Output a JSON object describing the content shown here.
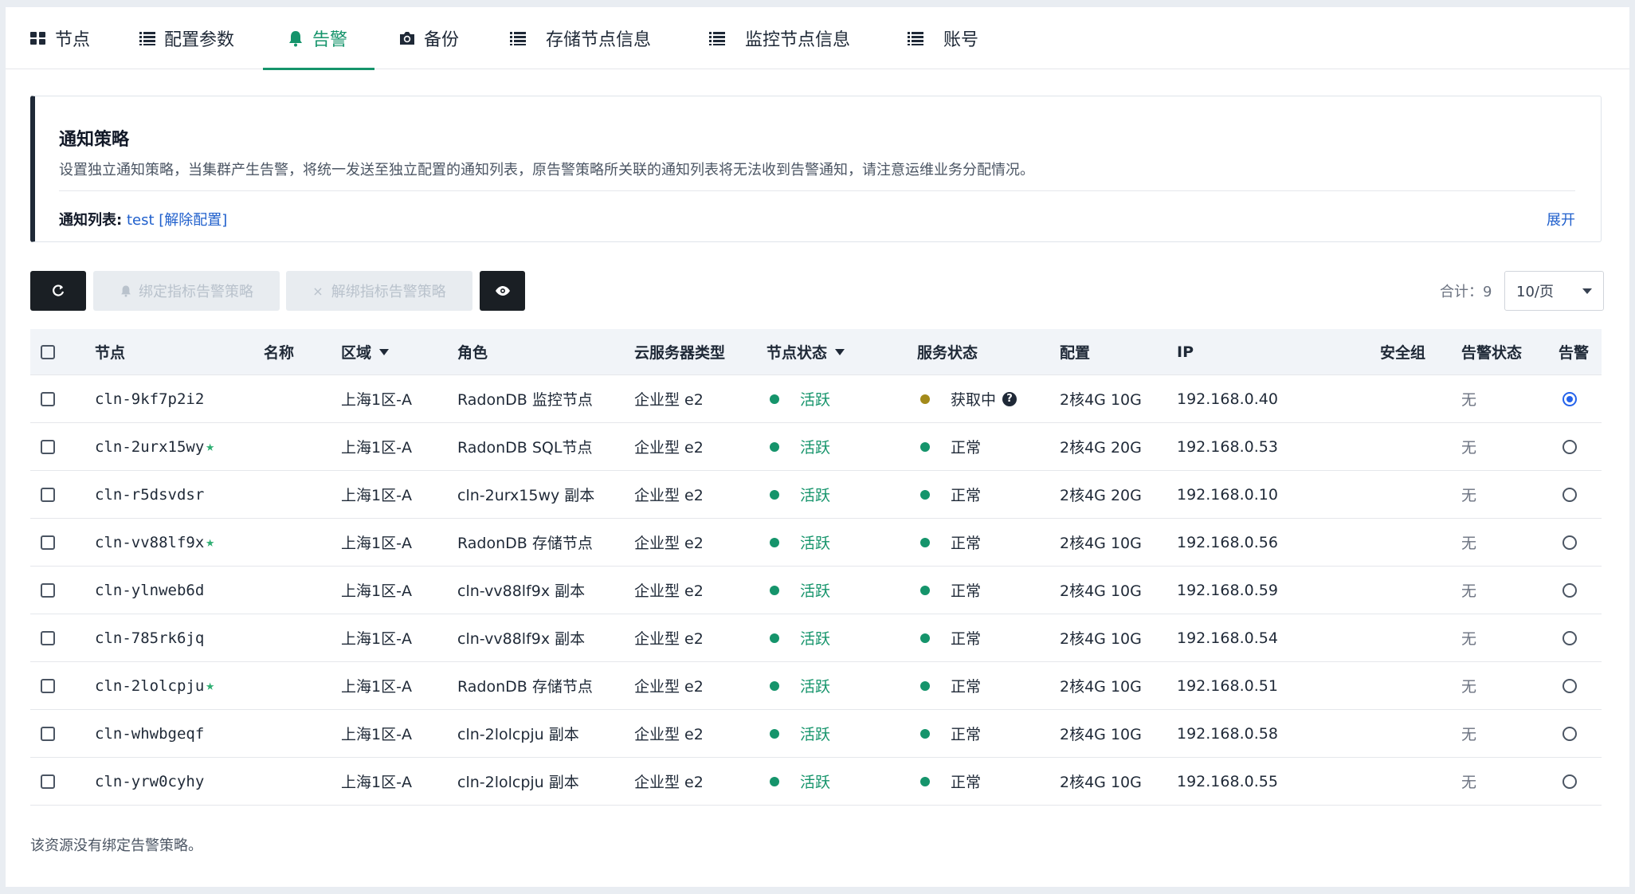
{
  "tabs": [
    {
      "label": "节点",
      "icon": "grid-icon"
    },
    {
      "label": "配置参数",
      "icon": "list-icon"
    },
    {
      "label": "告警",
      "icon": "bell-icon",
      "active": true
    },
    {
      "label": "备份",
      "icon": "camera-icon"
    },
    {
      "label": "存储节点信息",
      "icon": "list-icon"
    },
    {
      "label": "监控节点信息",
      "icon": "list-icon"
    },
    {
      "label": "账号",
      "icon": "list-icon"
    }
  ],
  "notice": {
    "title": "通知策略",
    "description": "设置独立通知策略，当集群产生告警，将统一发送至独立配置的通知列表，原告警策略所关联的通知列表将无法收到告警通知，请注意运维业务分配情况。",
    "list_label": "通知列表:",
    "list_value": "test",
    "unbind_label": "[解除配置]",
    "expand_label": "展开"
  },
  "toolbar": {
    "bind_label": "绑定指标告警策略",
    "unbind_label": "解绑指标告警策略",
    "total_label": "合计：9",
    "page_size": "10/页"
  },
  "table": {
    "headers": {
      "node": "节点",
      "name": "名称",
      "zone": "区域",
      "role": "角色",
      "server_type": "云服务器类型",
      "node_status": "节点状态",
      "service_status": "服务状态",
      "config": "配置",
      "ip": "IP",
      "security_group": "安全组",
      "alarm_status": "告警状态",
      "alarm": "告警"
    },
    "rows": [
      {
        "node": "cln-9kf7p2i2",
        "star": "",
        "zone": "上海1区-A",
        "role": "RadonDB 监控节点",
        "server_type": "企业型 e2",
        "node_status": "活跃",
        "service_status": "获取中",
        "config": "2核4G 10G",
        "ip": "192.168.0.40",
        "alarm_status": "无"
      },
      {
        "node": "cln-2urx15wy",
        "star": "★",
        "zone": "上海1区-A",
        "role": "RadonDB SQL节点",
        "server_type": "企业型 e2",
        "node_status": "活跃",
        "service_status": "正常",
        "config": "2核4G 20G",
        "ip": "192.168.0.53",
        "alarm_status": "无"
      },
      {
        "node": "cln-r5dsvdsr",
        "star": "",
        "zone": "上海1区-A",
        "role": "cln-2urx15wy 副本",
        "server_type": "企业型 e2",
        "node_status": "活跃",
        "service_status": "正常",
        "config": "2核4G 20G",
        "ip": "192.168.0.10",
        "alarm_status": "无"
      },
      {
        "node": "cln-vv88lf9x",
        "star": "★",
        "zone": "上海1区-A",
        "role": "RadonDB 存储节点",
        "server_type": "企业型 e2",
        "node_status": "活跃",
        "service_status": "正常",
        "config": "2核4G 10G",
        "ip": "192.168.0.56",
        "alarm_status": "无"
      },
      {
        "node": "cln-ylnweb6d",
        "star": "",
        "zone": "上海1区-A",
        "role": "cln-vv88lf9x 副本",
        "server_type": "企业型 e2",
        "node_status": "活跃",
        "service_status": "正常",
        "config": "2核4G 10G",
        "ip": "192.168.0.59",
        "alarm_status": "无"
      },
      {
        "node": "cln-785rk6jq",
        "star": "",
        "zone": "上海1区-A",
        "role": "cln-vv88lf9x 副本",
        "server_type": "企业型 e2",
        "node_status": "活跃",
        "service_status": "正常",
        "config": "2核4G 10G",
        "ip": "192.168.0.54",
        "alarm_status": "无"
      },
      {
        "node": "cln-2lolcpju",
        "star": "★",
        "zone": "上海1区-A",
        "role": "RadonDB 存储节点",
        "server_type": "企业型 e2",
        "node_status": "活跃",
        "service_status": "正常",
        "config": "2核4G 10G",
        "ip": "192.168.0.51",
        "alarm_status": "无"
      },
      {
        "node": "cln-whwbgeqf",
        "star": "",
        "zone": "上海1区-A",
        "role": "cln-2lolcpju 副本",
        "server_type": "企业型 e2",
        "node_status": "活跃",
        "service_status": "正常",
        "config": "2核4G 10G",
        "ip": "192.168.0.58",
        "alarm_status": "无"
      },
      {
        "node": "cln-yrw0cyhy",
        "star": "",
        "zone": "上海1区-A",
        "role": "cln-2lolcpju 副本",
        "server_type": "企业型 e2",
        "node_status": "活跃",
        "service_status": "正常",
        "config": "2核4G 10G",
        "ip": "192.168.0.55",
        "alarm_status": "无"
      }
    ]
  },
  "footer_note": "该资源没有绑定告警策略。",
  "colors": {
    "accent": "#15946b",
    "link": "#1f5fcc",
    "active_dot": "#15946b",
    "fetching_dot": "#a38a1a",
    "radio_selected": "#2563eb"
  }
}
